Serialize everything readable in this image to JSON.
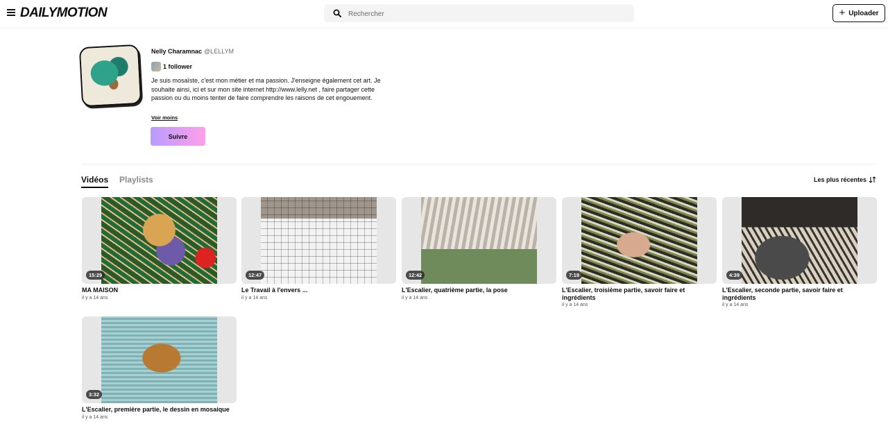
{
  "header": {
    "logo": "DAILYMOTION",
    "search_placeholder": "Rechercher",
    "upload_label": "Uploader",
    "upload_plus": "+"
  },
  "profile": {
    "name": "Nelly Charamnac",
    "handle": "@LELLYM",
    "followers": "1 follower",
    "bio": "Je suis mosaïste, c'est mon métier et ma passion. J'enseigne également cet art. Je souhaite ainsi, ici et sur mon site internet http://www.lelly.net , faire partager cette passion ou du moins tenter de faire comprendre les raisons de cet engouement.",
    "see_less": "Voir moins",
    "follow_label": "Suivre"
  },
  "tabs": [
    {
      "label": "Vidéos",
      "active": true
    },
    {
      "label": "Playlists",
      "active": false
    }
  ],
  "sort_label": "Les plus récentes",
  "sort_icon": "sort-arrows-icon",
  "videos": [
    {
      "title": "MA MAISON",
      "duration": "15:29",
      "age": "il y a 14 ans"
    },
    {
      "title": "Le Travail à l'envers ...",
      "duration": "12:47",
      "age": "il y a 14 ans"
    },
    {
      "title": "L'Escalier, quatrième partie, la pose",
      "duration": "12:42",
      "age": "il y a 14 ans"
    },
    {
      "title": "L'Escalier, troisième partie, savoir faire et ingrédients",
      "duration": "7:19",
      "age": "il y a 14 ans"
    },
    {
      "title": "L'Escalier, seconde partie, savoir faire et ingrédients",
      "duration": "4:39",
      "age": "il y a 14 ans"
    },
    {
      "title": "L'Escalier, première partie, le dessin en mosaique",
      "duration": "3:32",
      "age": "il y a 14 ans"
    }
  ]
}
